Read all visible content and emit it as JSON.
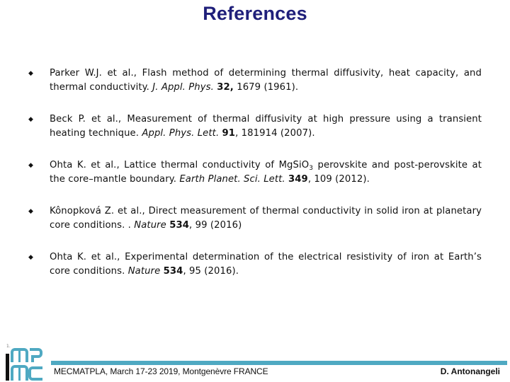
{
  "slide": {
    "title": "References"
  },
  "references": [
    {
      "html": "Parker W.J. et al., Flash method of determining thermal diffusivity, heat capacity, and thermal conductivity. <i>J. Appl. Phys.</i> <b>32,</b> 1679 (1961).",
      "authors": "Parker W.J. et al.",
      "title": "Flash method of determining thermal diffusivity, heat capacity, and thermal conductivity.",
      "journal": "J. Appl. Phys.",
      "volume": "32",
      "pages": "1679",
      "year": "1961"
    },
    {
      "html": "Beck P. et al., Measurement of thermal diffusivity at high pressure using a transient heating technique. <i>Appl. Phys. Lett.</i> <b>91</b>, 181914 (2007).",
      "authors": "Beck P. et al.",
      "title": "Measurement of thermal diffusivity at high pressure using a transient heating technique.",
      "journal": "Appl. Phys. Lett.",
      "volume": "91",
      "pages": "181914",
      "year": "2007"
    },
    {
      "html": "Ohta K. et al., Lattice thermal conductivity of MgSiO<sub>3</sub> perovskite and post-perovskite at the core–mantle boundary. <i>Earth Planet. Sci. Lett.</i> <b>349</b>, 109 (2012).",
      "authors": "Ohta K. et al.",
      "title": "Lattice thermal conductivity of MgSiO3 perovskite and post-perovskite at the core–mantle boundary.",
      "journal": "Earth Planet. Sci. Lett.",
      "volume": "349",
      "pages": "109",
      "year": "2012"
    },
    {
      "html": "Kônopková Z. et al., Direct measurement of thermal conductivity in solid iron at planetary core conditions. . <i>Nature</i> <b>534</b>, 99 (2016)",
      "authors": "Kônopková Z. et al.",
      "title": "Direct measurement of thermal conductivity in solid iron at planetary core conditions.",
      "journal": "Nature",
      "volume": "534",
      "pages": "99",
      "year": "2016"
    },
    {
      "html": "Ohta K. et al., Experimental determination of the electrical resistivity of iron at Earth’s core conditions. <i>Nature</i> <b>534</b>, 95 (2016).",
      "authors": "Ohta K. et al.",
      "title": "Experimental determination of the electrical resistivity of iron at Earth’s core conditions.",
      "journal": "Nature",
      "volume": "534",
      "pages": "95",
      "year": "2016"
    }
  ],
  "bullet_glyph": "◆",
  "footer": {
    "conference": "MECMATPLA, March 17-23 2019, Montgenèvre FRANCE",
    "author": "D. Antonangeli",
    "slide_marker": "1.",
    "logo_name": "IMPMC logo",
    "colors": {
      "bar": "#4fa9c2",
      "logo_accent": "#4fa9c2",
      "title": "#1f1f7a"
    }
  }
}
